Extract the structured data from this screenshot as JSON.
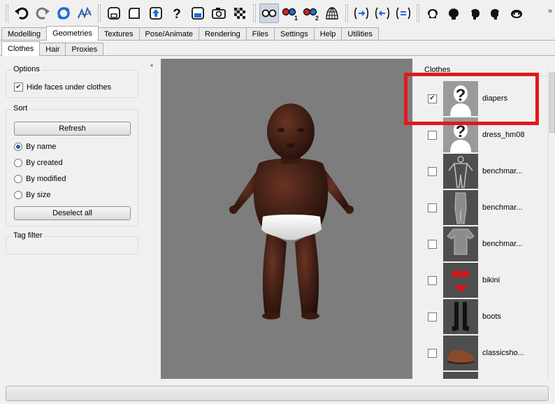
{
  "toolbar": {
    "buttons": [
      {
        "icon": "undo-icon"
      },
      {
        "icon": "redo-icon"
      },
      {
        "icon": "reset-icon"
      },
      {
        "icon": "smooth-icon"
      },
      {
        "icon": "new-file-icon"
      },
      {
        "icon": "open-file-icon"
      },
      {
        "icon": "export-icon"
      },
      {
        "icon": "help-icon"
      },
      {
        "icon": "save-icon"
      },
      {
        "icon": "screenshot-icon"
      },
      {
        "icon": "checker-icon"
      },
      {
        "icon": "glasses-icon"
      },
      {
        "icon": "stereo-1-icon"
      },
      {
        "icon": "stereo-2-icon"
      },
      {
        "icon": "wireframe-icon"
      },
      {
        "icon": "front-view-icon"
      },
      {
        "icon": "back-view-icon"
      },
      {
        "icon": "side-view-icon"
      },
      {
        "icon": "head-front-icon"
      },
      {
        "icon": "head-back-icon"
      },
      {
        "icon": "head-left-icon"
      },
      {
        "icon": "head-right-icon"
      },
      {
        "icon": "head-top-icon"
      }
    ],
    "more": "»"
  },
  "tabs": {
    "main": [
      "Modelling",
      "Geometries",
      "Textures",
      "Pose/Animate",
      "Rendering",
      "Files",
      "Settings",
      "Help",
      "Utilities"
    ],
    "main_active": "Geometries",
    "sub": [
      "Clothes",
      "Hair",
      "Proxies"
    ],
    "sub_active": "Clothes"
  },
  "left": {
    "options_title": "Options",
    "hide_faces_label": "Hide faces under clothes",
    "hide_faces_checked": true,
    "sort_title": "Sort",
    "refresh_label": "Refresh",
    "sort_options": [
      "By name",
      "By created",
      "By modified",
      "By size"
    ],
    "sort_selected": "By name",
    "deselect_label": "Deselect all",
    "tag_filter_title": "Tag filter"
  },
  "right": {
    "title": "Clothes",
    "items": [
      {
        "label": "diapers",
        "checked": true,
        "thumb": "unknown-figure"
      },
      {
        "label": "dress_hm08",
        "checked": false,
        "thumb": "unknown-figure"
      },
      {
        "label": "benchmar...",
        "checked": false,
        "thumb": "mesh-full"
      },
      {
        "label": "benchmar...",
        "checked": false,
        "thumb": "mesh-legs"
      },
      {
        "label": "benchmar...",
        "checked": false,
        "thumb": "mesh-top"
      },
      {
        "label": "bikini",
        "checked": false,
        "thumb": "bikini"
      },
      {
        "label": "boots",
        "checked": false,
        "thumb": "boots"
      },
      {
        "label": "classicsho...",
        "checked": false,
        "thumb": "shoes"
      }
    ]
  },
  "colors": {
    "viewport_bg": "#7d7d7d",
    "highlight": "#e3171f",
    "skin": "#4a2418",
    "diaper": "#f2f2f2"
  }
}
